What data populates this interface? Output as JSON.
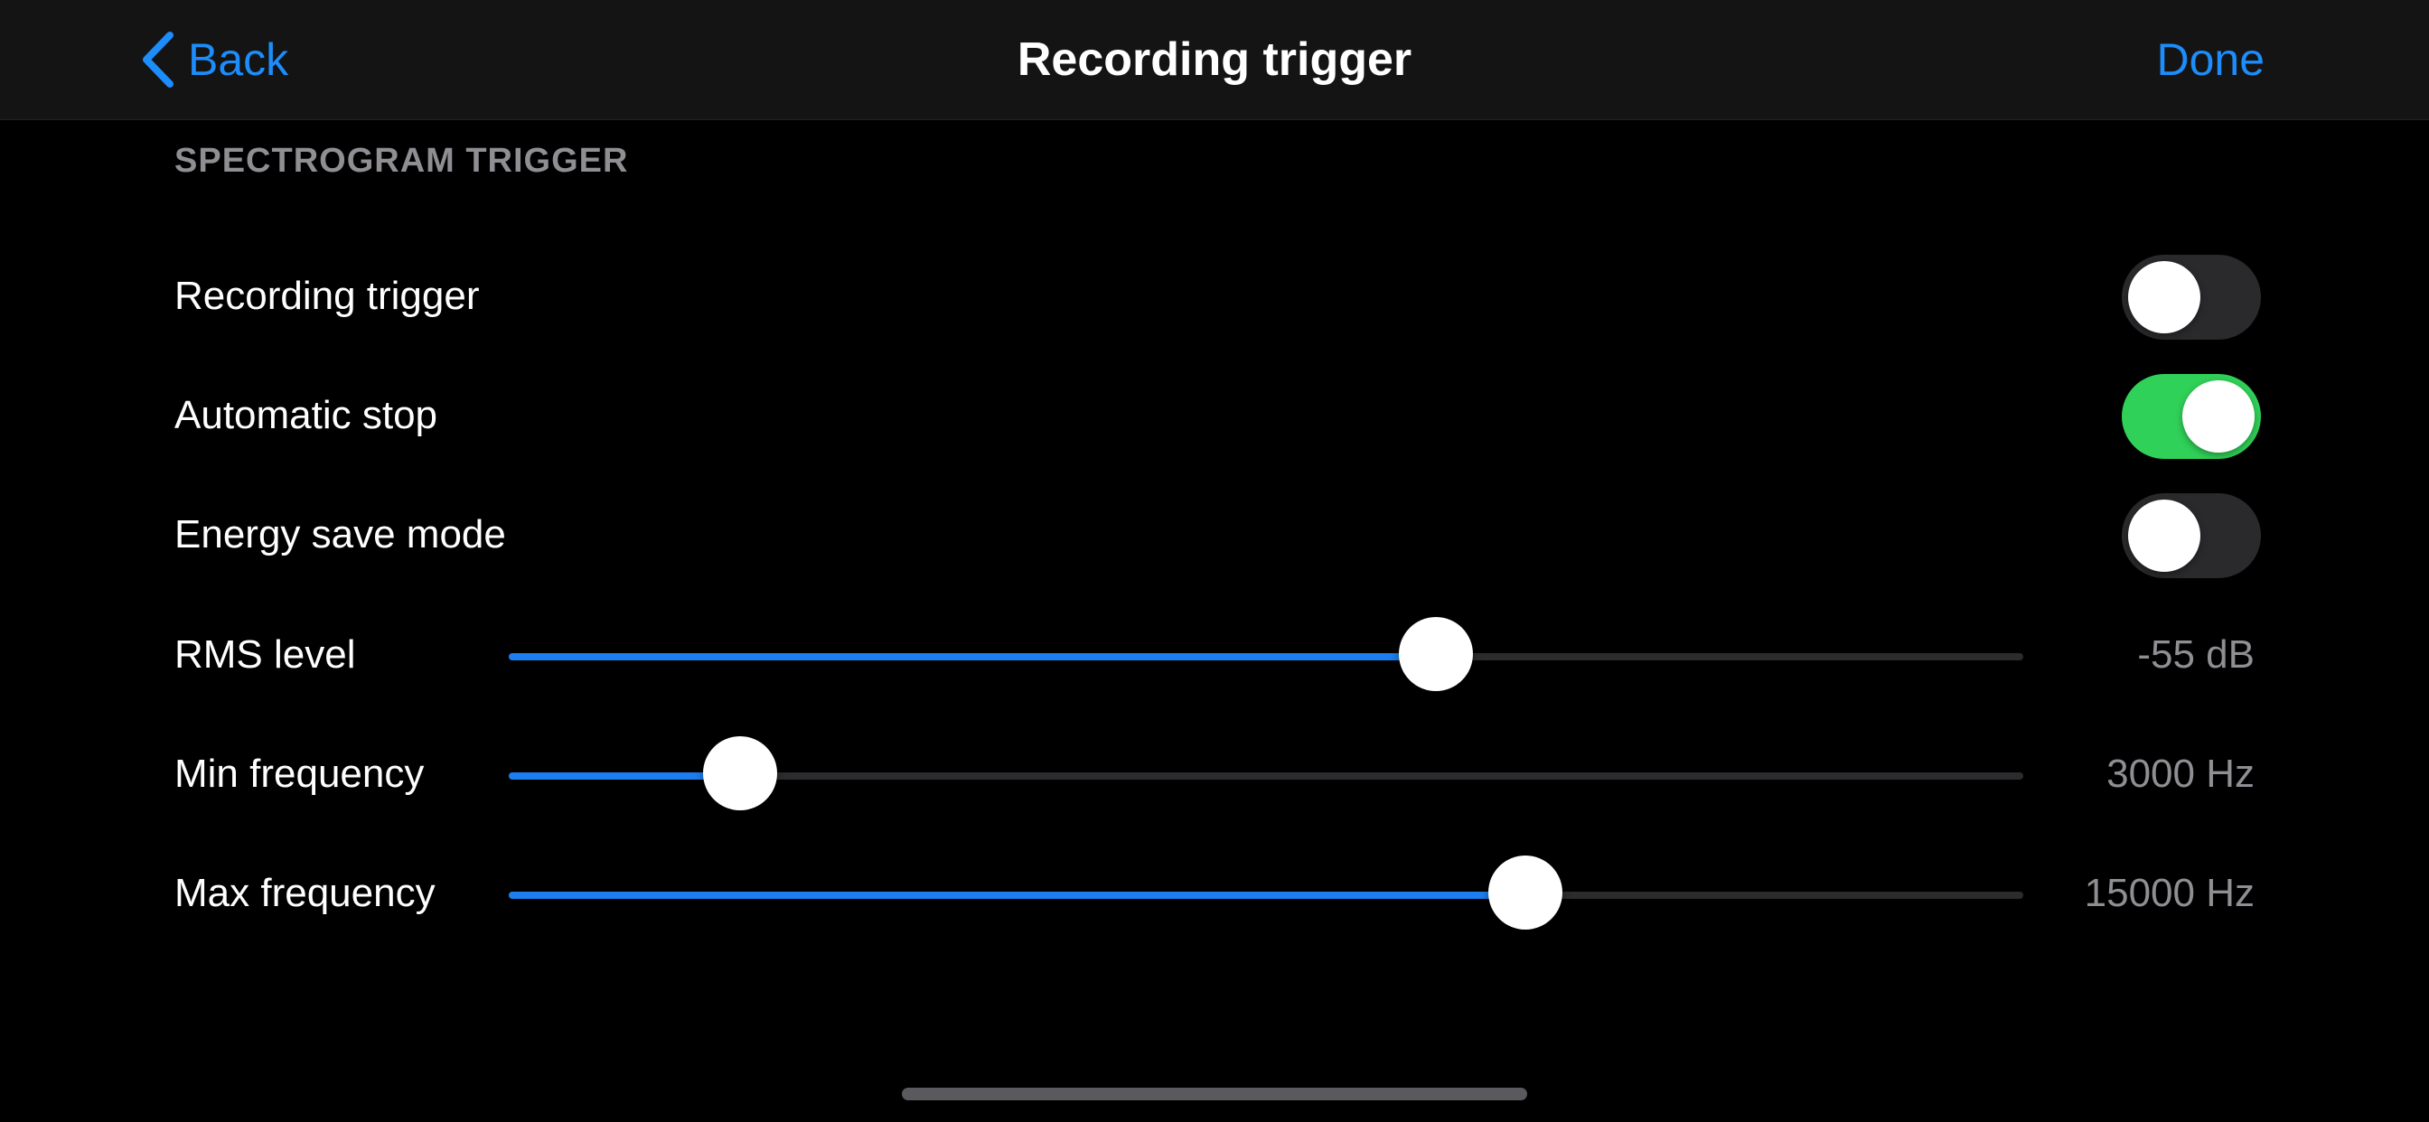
{
  "colors": {
    "accent": "#1c8dfa",
    "toggle_on": "#30d158",
    "toggle_off": "#2a2a2d",
    "slider_fill": "#1c7ef0",
    "secondary_text": "#8e8e93"
  },
  "nav": {
    "back_label": "Back",
    "back_icon": "chevron-left-icon",
    "title": "Recording trigger",
    "done_label": "Done"
  },
  "section": {
    "header": "SPECTROGRAM TRIGGER"
  },
  "toggles": [
    {
      "label": "Recording trigger",
      "on": false
    },
    {
      "label": "Automatic stop",
      "on": true
    },
    {
      "label": "Energy save mode",
      "on": false
    }
  ],
  "sliders": [
    {
      "label": "RMS level",
      "value_text": "-55 dB",
      "fraction": 0.612
    },
    {
      "label": "Min frequency",
      "value_text": "3000 Hz",
      "fraction": 0.153
    },
    {
      "label": "Max frequency",
      "value_text": "15000 Hz",
      "fraction": 0.671
    }
  ]
}
